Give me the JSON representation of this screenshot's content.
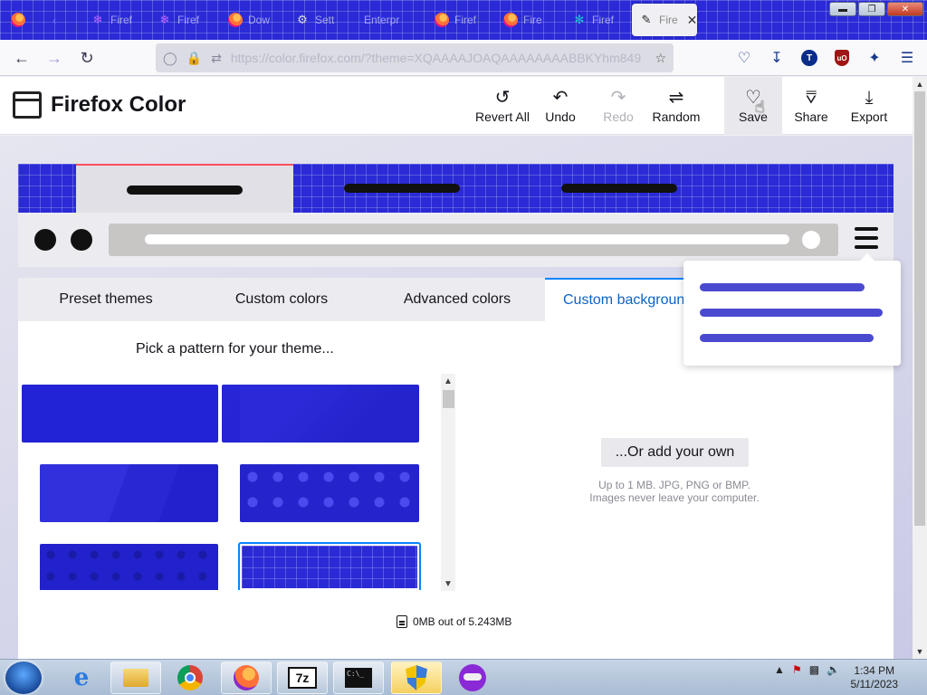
{
  "browser": {
    "tabs": [
      {
        "icon": "firefox-icon",
        "label": ""
      },
      {
        "icon": "tab-placeholder-icon",
        "label": ""
      },
      {
        "icon": "snowflake-icon",
        "label": "Firef"
      },
      {
        "icon": "snowflake-icon",
        "label": "Firef"
      },
      {
        "icon": "firefox-icon",
        "label": "Dow"
      },
      {
        "icon": "gear-icon",
        "label": "Sett"
      },
      {
        "icon": "none",
        "label": "Enterpr"
      },
      {
        "icon": "firefox-icon",
        "label": "Firef"
      },
      {
        "icon": "firefox-icon",
        "label": "Fire"
      },
      {
        "icon": "puzzle-icon",
        "label": "Firef"
      },
      {
        "icon": "firefox-color-icon",
        "label": "Fire"
      }
    ],
    "url": "https://color.firefox.com/?theme=XQAAAAJOAQAAAAAAAABBKYhm849"
  },
  "app": {
    "title": "Firefox Color",
    "toolbar": {
      "revert_all": "Revert All",
      "undo": "Undo",
      "redo": "Redo",
      "random": "Random",
      "save": "Save",
      "share": "Share",
      "export": "Export"
    },
    "editor_tabs": [
      "Preset themes",
      "Custom colors",
      "Advanced colors",
      "Custom backgrounds"
    ],
    "pick_title": "Pick a pattern for your theme...",
    "add_own": "...Or add your own",
    "help_line1": "Up to 1 MB. JPG, PNG or BMP.",
    "help_line2": "Images never leave your computer.",
    "storage": "0MB out of 5.243MB"
  },
  "colors": {
    "accent": "#2a2ad6",
    "tab_indicator": "#ff5060",
    "link_blue": "#0a64c8"
  },
  "taskbar": {
    "items": [
      "explorer-icon",
      "ie-icon",
      "chrome-icon",
      "firefox-icon",
      "7zip-icon",
      "cmd-icon",
      "shield-icon",
      "mask-icon"
    ],
    "time": "1:34 PM",
    "date": "5/11/2023"
  }
}
